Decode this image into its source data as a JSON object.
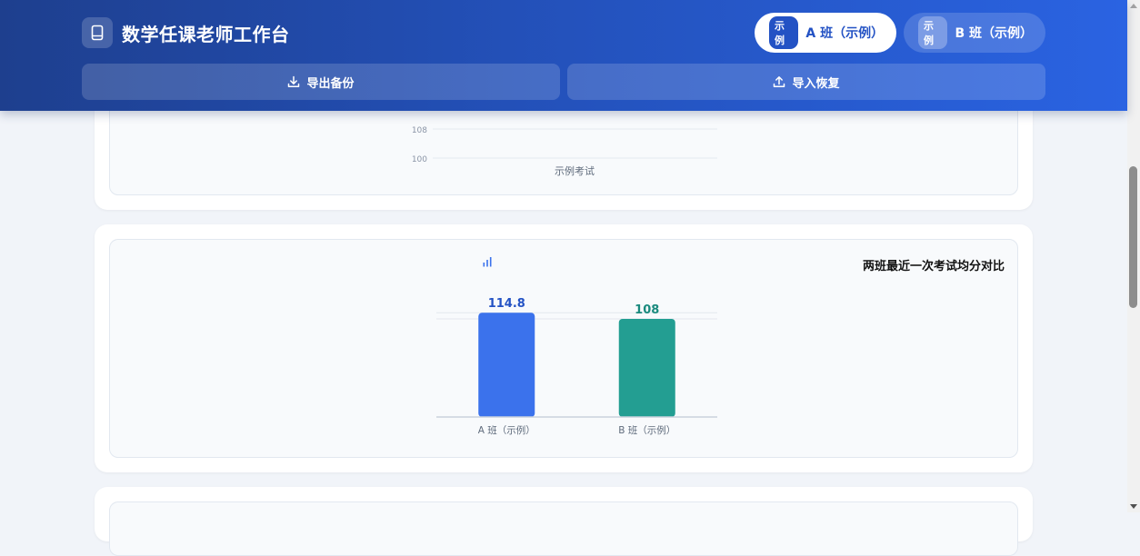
{
  "header": {
    "app_title": "数学任课老师工作台",
    "app_icon": "book-icon",
    "classes": [
      {
        "tag": "示例",
        "label": "A 班（示例）",
        "active": true
      },
      {
        "tag": "示例",
        "label": "B 班（示例）",
        "active": false
      }
    ],
    "export_label": "导出备份",
    "import_label": "导入恢复"
  },
  "trend_chart": {
    "visible_ticks": [
      "108",
      "100"
    ],
    "category": "示例考试"
  },
  "compare_chart": {
    "icon": "bar-chart-icon",
    "chart_data": {
      "type": "bar",
      "title": "两班最近一次考试均分对比",
      "categories": [
        "A 班（示例）",
        "B 班（示例）"
      ],
      "values": [
        114.8,
        108
      ],
      "value_labels": [
        "114.8",
        "108"
      ],
      "colors": [
        "#3b72ec",
        "#239e92"
      ],
      "reference_lines": [
        114.8,
        108
      ],
      "ylim": [
        0,
        115
      ],
      "grid": false,
      "legend": "none"
    }
  },
  "colors": {
    "header_start": "#1e3f8e",
    "header_end": "#2a63e2",
    "accent": "#2352c4",
    "page_bg": "#f1f4f9"
  }
}
